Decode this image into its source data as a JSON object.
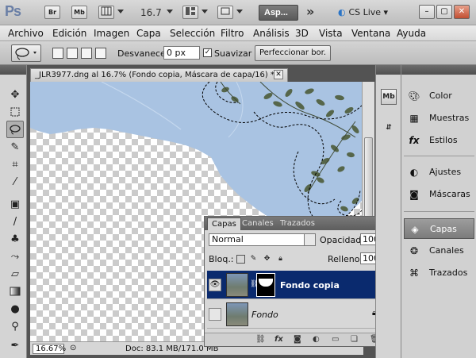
{
  "app": {
    "logo": "Ps",
    "bridge_label": "Br",
    "minibridge_label": "Mb",
    "zoom_value": "16.7",
    "workspace_button": "Asp...",
    "cslive_label": "CS Live",
    "min_glyph": "–",
    "restore_glyph": "▢",
    "close_glyph": "✕"
  },
  "menu": [
    "Archivo",
    "Edición",
    "Imagen",
    "Capa",
    "Selección",
    "Filtro",
    "Análisis",
    "3D",
    "Vista",
    "Ventana",
    "Ayuda"
  ],
  "options": {
    "feather_label": "Desvanecer:",
    "feather_value": "0 px",
    "antialias_label": "Suavizar",
    "antialias_checked": "✓",
    "refine_label": "Perfeccionar bor."
  },
  "document": {
    "tab_title": "_JLR3977.dng al 16.7% (Fondo copia, Máscara de capa/16) *",
    "close_glyph": "✕",
    "zoom": "16.67%",
    "doc_info": "Doc: 83.1 MB/171.0 MB"
  },
  "layers_panel": {
    "tabs": [
      "Capas",
      "Canales",
      "Trazados"
    ],
    "active_tab": 0,
    "menu_glyph": "▸▸ ≡",
    "blend_mode": "Normal",
    "opacity_label": "Opacidad:",
    "opacity_value": "100%",
    "lock_label": "Bloq.:",
    "fill_label": "Relleno:",
    "fill_value": "100%",
    "layers": [
      {
        "name": "Fondo copia",
        "selected": true,
        "visible": true
      },
      {
        "name": "Fondo",
        "selected": false,
        "visible": false,
        "locked": true
      }
    ],
    "bottom_icons": [
      "link-icon",
      "fx-icon",
      "mask-icon",
      "adjustment-icon",
      "folder-icon",
      "new-layer-icon",
      "trash-icon"
    ]
  },
  "right_strip_icons": [
    {
      "name": "minibridge-icon",
      "label": "Mb"
    }
  ],
  "dock": {
    "items": [
      "Color",
      "Muestras",
      "Estilos",
      "Ajustes",
      "Máscaras",
      "Capas",
      "Canales",
      "Trazados"
    ],
    "active": "Capas"
  },
  "colors": {
    "selected_layer": "#0a2a6e",
    "sky": "#a9c3e2",
    "chrome": "#d4d4d4"
  }
}
